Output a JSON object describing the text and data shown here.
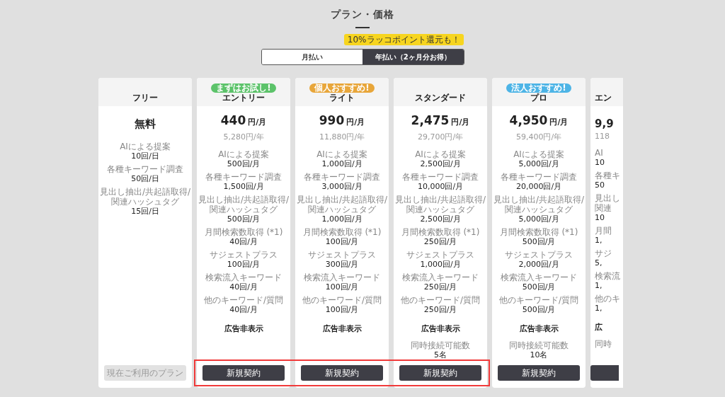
{
  "title": "プラン・価格",
  "promo": "10%ラッコポイント還元も！",
  "billing_tabs": [
    {
      "label": "月払い",
      "selected": false
    },
    {
      "label": "年払い（2ヶ月分お得）",
      "selected": true
    }
  ],
  "plans": [
    {
      "name": "フリー",
      "price": "無料",
      "features": [
        {
          "kind": "metric",
          "label": "AIによる提案",
          "value": "10回/日"
        },
        {
          "kind": "metric",
          "label": "各種キーワード調査",
          "value": "50回/日"
        },
        {
          "kind": "metric",
          "label": "見出し抽出/共起語取得/",
          "label_2": "関連ハッシュタグ",
          "value": "15回/日"
        }
      ],
      "button": {
        "label": "現在ご利用のプラン",
        "disabled": true
      },
      "highlighted": false
    },
    {
      "name": "エントリー",
      "badge": {
        "text": "まずはお試し!",
        "color": "#5cc36a"
      },
      "price": "440",
      "unit": "円/月",
      "annual": "5,280円/年",
      "features": [
        {
          "kind": "metric",
          "label": "AIによる提案",
          "value": "500回/月"
        },
        {
          "kind": "metric",
          "label": "各種キーワード調査",
          "value": "1,500回/月"
        },
        {
          "kind": "metric",
          "label": "見出し抽出/共起語取得/",
          "label_2": "関連ハッシュタグ",
          "value": "500回/月"
        },
        {
          "kind": "metric",
          "label": "月間検索数取得 (*1)",
          "value": "40回/月"
        },
        {
          "kind": "metric",
          "label": "サジェストプラス",
          "value": "100回/月"
        },
        {
          "kind": "metric",
          "label": "検索流入キーワード",
          "value": "40回/月"
        },
        {
          "kind": "metric",
          "label": "他のキーワード/質問",
          "value": "40回/月"
        },
        {
          "kind": "flag",
          "value": "広告非表示"
        }
      ],
      "button": {
        "label": "新規契約",
        "disabled": false
      },
      "highlighted": true
    },
    {
      "name": "ライト",
      "badge": {
        "text": "個人おすすめ!",
        "color": "#e8a63a"
      },
      "price": "990",
      "unit": "円/月",
      "annual": "11,880円/年",
      "features": [
        {
          "kind": "metric",
          "label": "AIによる提案",
          "value": "1,000回/月"
        },
        {
          "kind": "metric",
          "label": "各種キーワード調査",
          "value": "3,000回/月"
        },
        {
          "kind": "metric",
          "label": "見出し抽出/共起語取得/",
          "label_2": "関連ハッシュタグ",
          "value": "1,000回/月"
        },
        {
          "kind": "metric",
          "label": "月間検索数取得 (*1)",
          "value": "100回/月"
        },
        {
          "kind": "metric",
          "label": "サジェストプラス",
          "value": "300回/月"
        },
        {
          "kind": "metric",
          "label": "検索流入キーワード",
          "value": "100回/月"
        },
        {
          "kind": "metric",
          "label": "他のキーワード/質問",
          "value": "100回/月"
        },
        {
          "kind": "flag",
          "value": "広告非表示"
        }
      ],
      "button": {
        "label": "新規契約",
        "disabled": false
      },
      "highlighted": true
    },
    {
      "name": "スタンダード",
      "price": "2,475",
      "unit": "円/月",
      "annual": "29,700円/年",
      "features": [
        {
          "kind": "metric",
          "label": "AIによる提案",
          "value": "2,500回/月"
        },
        {
          "kind": "metric",
          "label": "各種キーワード調査",
          "value": "10,000回/月"
        },
        {
          "kind": "metric",
          "label": "見出し抽出/共起語取得/",
          "label_2": "関連ハッシュタグ",
          "value": "2,500回/月"
        },
        {
          "kind": "metric",
          "label": "月間検索数取得 (*1)",
          "value": "250回/月"
        },
        {
          "kind": "metric",
          "label": "サジェストプラス",
          "value": "1,000回/月"
        },
        {
          "kind": "metric",
          "label": "検索流入キーワード",
          "value": "250回/月"
        },
        {
          "kind": "metric",
          "label": "他のキーワード/質問",
          "value": "250回/月"
        },
        {
          "kind": "flag",
          "value": "広告非表示"
        },
        {
          "kind": "metric",
          "label": "同時接続可能数",
          "value": "5名"
        }
      ],
      "button": {
        "label": "新規契約",
        "disabled": false
      },
      "highlighted": true
    },
    {
      "name": "プロ",
      "badge": {
        "text": "法人おすすめ!",
        "color": "#4db4e6"
      },
      "price": "4,950",
      "unit": "円/月",
      "annual": "59,400円/年",
      "features": [
        {
          "kind": "metric",
          "label": "AIによる提案",
          "value": "5,000回/月"
        },
        {
          "kind": "metric",
          "label": "各種キーワード調査",
          "value": "20,000回/月"
        },
        {
          "kind": "metric",
          "label": "見出し抽出/共起語取得/",
          "label_2": "関連ハッシュタグ",
          "value": "5,000回/月"
        },
        {
          "kind": "metric",
          "label": "月間検索数取得 (*1)",
          "value": "500回/月"
        },
        {
          "kind": "metric",
          "label": "サジェストプラス",
          "value": "2,000回/月"
        },
        {
          "kind": "metric",
          "label": "検索流入キーワード",
          "value": "500回/月"
        },
        {
          "kind": "metric",
          "label": "他のキーワード/質問",
          "value": "500回/月"
        },
        {
          "kind": "flag",
          "value": "広告非表示"
        },
        {
          "kind": "metric",
          "label": "同時接続可能数",
          "value": "10名"
        }
      ],
      "button": {
        "label": "新規契約",
        "disabled": false
      },
      "highlighted": false
    },
    {
      "name": "エン",
      "partial": true,
      "price": "9,9",
      "annual": "118",
      "features": [
        {
          "kind": "metric",
          "label": "AI",
          "value": "10"
        },
        {
          "kind": "metric",
          "label": "各種キ",
          "value": "50"
        },
        {
          "kind": "metric",
          "label": "見出し",
          "label_2": "関連",
          "value": "10"
        },
        {
          "kind": "metric",
          "label": "月間",
          "value": "1,"
        },
        {
          "kind": "metric",
          "label": "サジ",
          "value": "5,"
        },
        {
          "kind": "metric",
          "label": "検索流",
          "value": "1,"
        },
        {
          "kind": "metric",
          "label": "他のキ",
          "value": "1,"
        },
        {
          "kind": "flag",
          "value": "広"
        },
        {
          "kind": "metric",
          "label": "同時"
        }
      ],
      "button": {
        "disabled": false
      },
      "highlighted": false
    }
  ]
}
